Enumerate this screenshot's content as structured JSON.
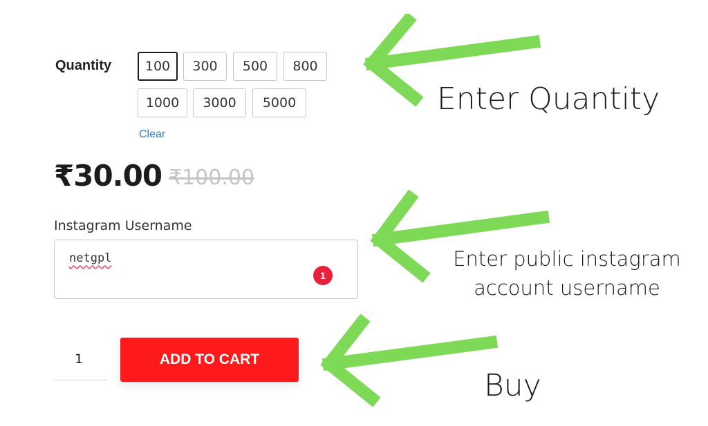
{
  "product": {
    "quantity_label": "Quantity",
    "quantity_options": [
      "100",
      "300",
      "500",
      "800",
      "1000",
      "3000",
      "5000"
    ],
    "selected_quantity": "100",
    "clear_label": "Clear",
    "price_sale": "₹30.00",
    "price_regular": "₹100.00",
    "username_label": "Instagram Username",
    "username_value": "netgpl",
    "error_count": "1",
    "cart_quantity": "1",
    "add_to_cart_label": "ADD TO CART",
    "accent_color": "#fe1a1a",
    "link_color": "#2f7ecb"
  },
  "annotations": {
    "enter_quantity": "Enter Quantity",
    "enter_username": "Enter public instagram account username",
    "buy": "Buy",
    "arrow_color": "#7ed957"
  }
}
